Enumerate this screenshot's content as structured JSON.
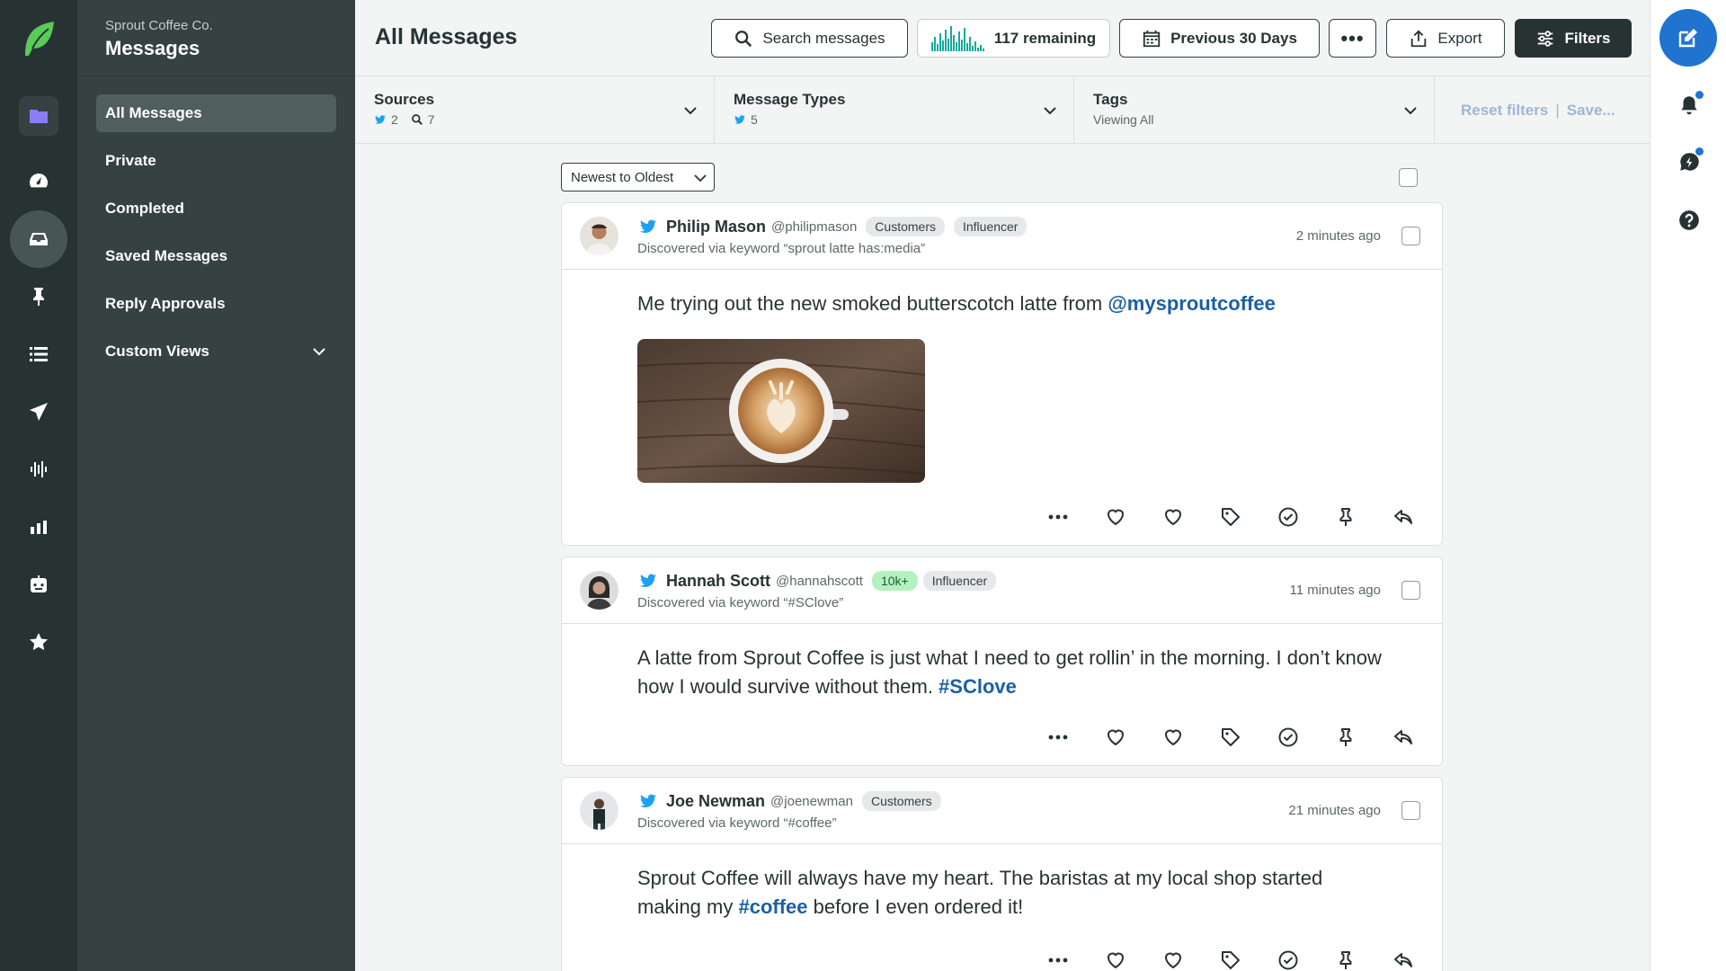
{
  "app": {
    "org": "Sprout Coffee Co.",
    "section": "Messages"
  },
  "nav": {
    "items": [
      {
        "label": "All Messages",
        "active": true
      },
      {
        "label": "Private"
      },
      {
        "label": "Completed"
      },
      {
        "label": "Saved Messages"
      },
      {
        "label": "Reply Approvals"
      },
      {
        "label": "Custom Views",
        "expandable": true
      }
    ]
  },
  "rail": [
    "sprout-leaf-logo",
    "folder-icon",
    "dashboard-icon",
    "inbox-icon",
    "pin-icon",
    "list-icon",
    "send-icon",
    "listening-icon",
    "reports-icon",
    "bot-icon",
    "star-icon"
  ],
  "header": {
    "title": "All Messages",
    "search_label": "Search messages",
    "remaining_label": "117 remaining",
    "date_label": "Previous 30 Days",
    "more_label": "•••",
    "export_label": "Export",
    "filters_label": "Filters"
  },
  "filters": {
    "sources": {
      "title": "Sources",
      "twitter_count": "2",
      "search_count": "7"
    },
    "types": {
      "title": "Message Types",
      "twitter_count": "5"
    },
    "tags": {
      "title": "Tags",
      "sub": "Viewing All"
    },
    "reset_label": "Reset filters",
    "separator": "|",
    "save_label": "Save..."
  },
  "sort": {
    "label": "Newest to Oldest"
  },
  "messages": [
    {
      "name": "Philip Mason",
      "handle": "@philipmason",
      "tags": [
        "Customers",
        "Influencer"
      ],
      "discovered": "Discovered via keyword “sprout latte has:media”",
      "time": "2 minutes ago",
      "text_before": "Me trying out the new smoked butterscotch latte from ",
      "text_link": "@mysproutcoffee",
      "text_after": ""
    },
    {
      "name": "Hannah Scott",
      "handle": "@hannahscott",
      "badge": "10k+",
      "tags": [
        "Influencer"
      ],
      "discovered": "Discovered via keyword “#SClove”",
      "time": "11 minutes ago",
      "text_before": "A latte from Sprout Coffee is just what I need to get rollin’ in the morning. I don’t know how I would survive without them. ",
      "text_link": "#SClove",
      "text_after": ""
    },
    {
      "name": "Joe Newman",
      "handle": "@joenewman",
      "tags": [
        "Customers"
      ],
      "discovered": "Discovered via keyword “#coffee”",
      "time": "21 minutes ago",
      "text_before": "Sprout Coffee will always have my heart. The baristas at my local shop started making my ",
      "text_link": "#coffee",
      "text_after": " before I even ordered it!"
    }
  ],
  "action_icons": [
    "more-icon",
    "like-icon",
    "favorite-icon",
    "tag-icon",
    "complete-icon",
    "pin-icon",
    "reply-icon"
  ],
  "colors": {
    "rail": "#273333",
    "nav": "#364141",
    "accent": "#2074d0",
    "link": "#1c5fa5",
    "spark": "#16a99a"
  }
}
